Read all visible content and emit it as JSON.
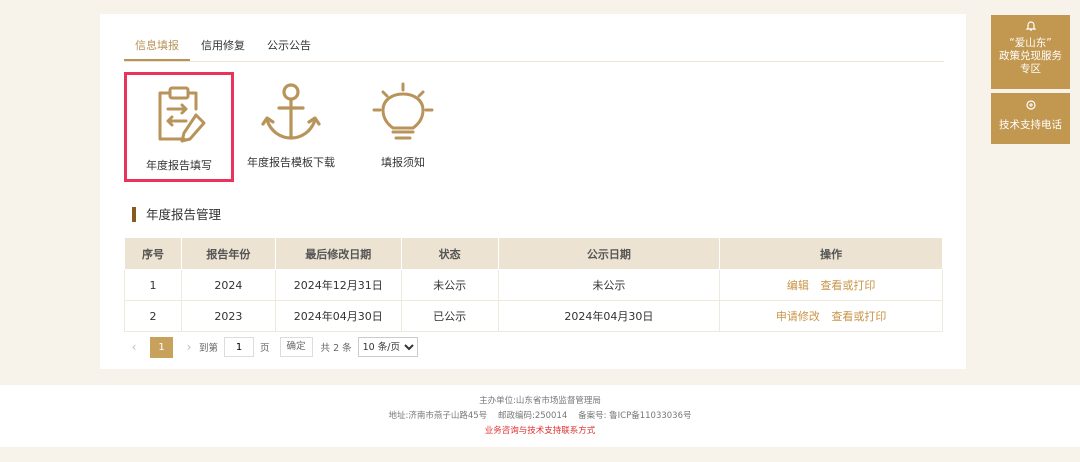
{
  "tabs": [
    {
      "label": "信息填报",
      "active": true
    },
    {
      "label": "信用修复",
      "active": false
    },
    {
      "label": "公示公告",
      "active": false
    }
  ],
  "tiles": [
    {
      "label": "年度报告填写",
      "icon": "clipboard-transfer-icon",
      "selected": true
    },
    {
      "label": "年度报告模板下载",
      "icon": "anchor-icon",
      "selected": false
    },
    {
      "label": "填报须知",
      "icon": "lightbulb-icon",
      "selected": false
    }
  ],
  "section": {
    "title": "年度报告管理"
  },
  "table": {
    "headers": [
      "序号",
      "报告年份",
      "最后修改日期",
      "状态",
      "公示日期",
      "操作"
    ],
    "rows": [
      {
        "index": "1",
        "year": "2024",
        "modified": "2024年12月31日",
        "status": "未公示",
        "publish": "未公示",
        "actions": [
          "编辑",
          "查看或打印"
        ]
      },
      {
        "index": "2",
        "year": "2023",
        "modified": "2024年04月30日",
        "status": "已公示",
        "publish": "2024年04月30日",
        "actions": [
          "申请修改",
          "查看或打印"
        ]
      }
    ]
  },
  "pager": {
    "prev": "‹",
    "next": "›",
    "current": "1",
    "goto_label": "到第",
    "goto_value": "1",
    "page_unit": "页",
    "confirm": "确定",
    "total": "共 2 条",
    "page_size": "10 条/页"
  },
  "side": {
    "policy_line1": "“爱山东”",
    "policy_line2": "政策兑现服务",
    "policy_line3": "专区",
    "support": "技术支持电话"
  },
  "footer": {
    "sponsor": "主办单位:山东省市场监督管理局",
    "address": "地址:济南市燕子山路45号    邮政编码:250014    备案号: 鲁ICP备11033036号",
    "contact": "业务咨询与技术支持联系方式"
  },
  "colors": {
    "accent": "#c2974f",
    "highlight": "#e8345a",
    "header": "#ece3d2"
  }
}
